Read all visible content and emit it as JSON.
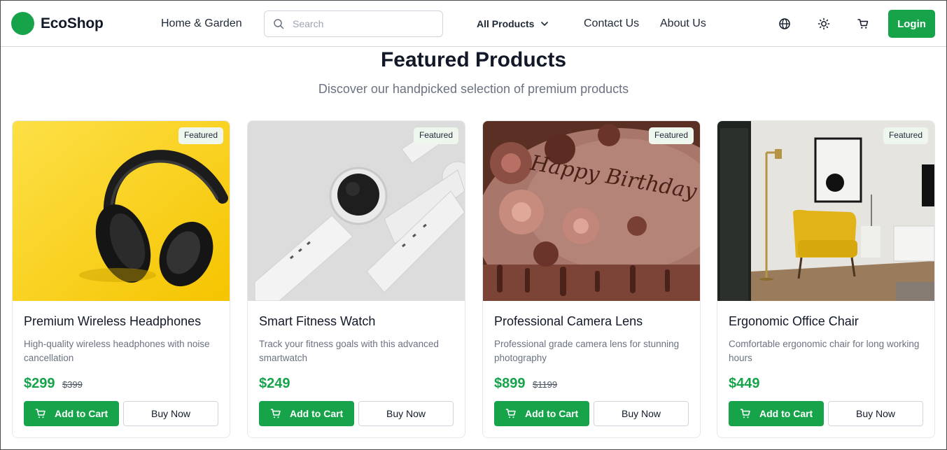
{
  "brand": {
    "name": "EcoShop",
    "color": "#16a34a"
  },
  "nav": {
    "category_link": "Home & Garden",
    "search_placeholder": "Search",
    "products_dropdown": "All Products",
    "contact": "Contact Us",
    "about": "About Us",
    "icons": [
      "globe-icon",
      "sun-icon",
      "cart-icon"
    ],
    "login": "Login"
  },
  "hero": {
    "title": "Featured Products",
    "subtitle": "Discover our handpicked selection of premium products"
  },
  "products": [
    {
      "badge": "Featured",
      "title": "Premium Wireless Headphones",
      "description": "High-quality wireless headphones with noise cancellation",
      "price": "$299",
      "old_price": "$399",
      "add_to_cart": "Add to Cart",
      "buy_now": "Buy Now",
      "image": "headphones-image"
    },
    {
      "badge": "Featured",
      "title": "Smart Fitness Watch",
      "description": "Track your fitness goals with this advanced smartwatch",
      "price": "$249",
      "old_price": "",
      "add_to_cart": "Add to Cart",
      "buy_now": "Buy Now",
      "image": "smartwatch-image"
    },
    {
      "badge": "Featured",
      "title": "Professional Camera Lens",
      "description": "Professional grade camera lens for stunning photography",
      "price": "$899",
      "old_price": "$1199",
      "add_to_cart": "Add to Cart",
      "buy_now": "Buy Now",
      "image": "birthday-cake-image",
      "image_text": "Happy Birthday"
    },
    {
      "badge": "Featured",
      "title": "Ergonomic Office Chair",
      "description": "Comfortable ergonomic chair for long working hours",
      "price": "$449",
      "old_price": "",
      "add_to_cart": "Add to Cart",
      "buy_now": "Buy Now",
      "image": "armchair-room-image"
    }
  ]
}
